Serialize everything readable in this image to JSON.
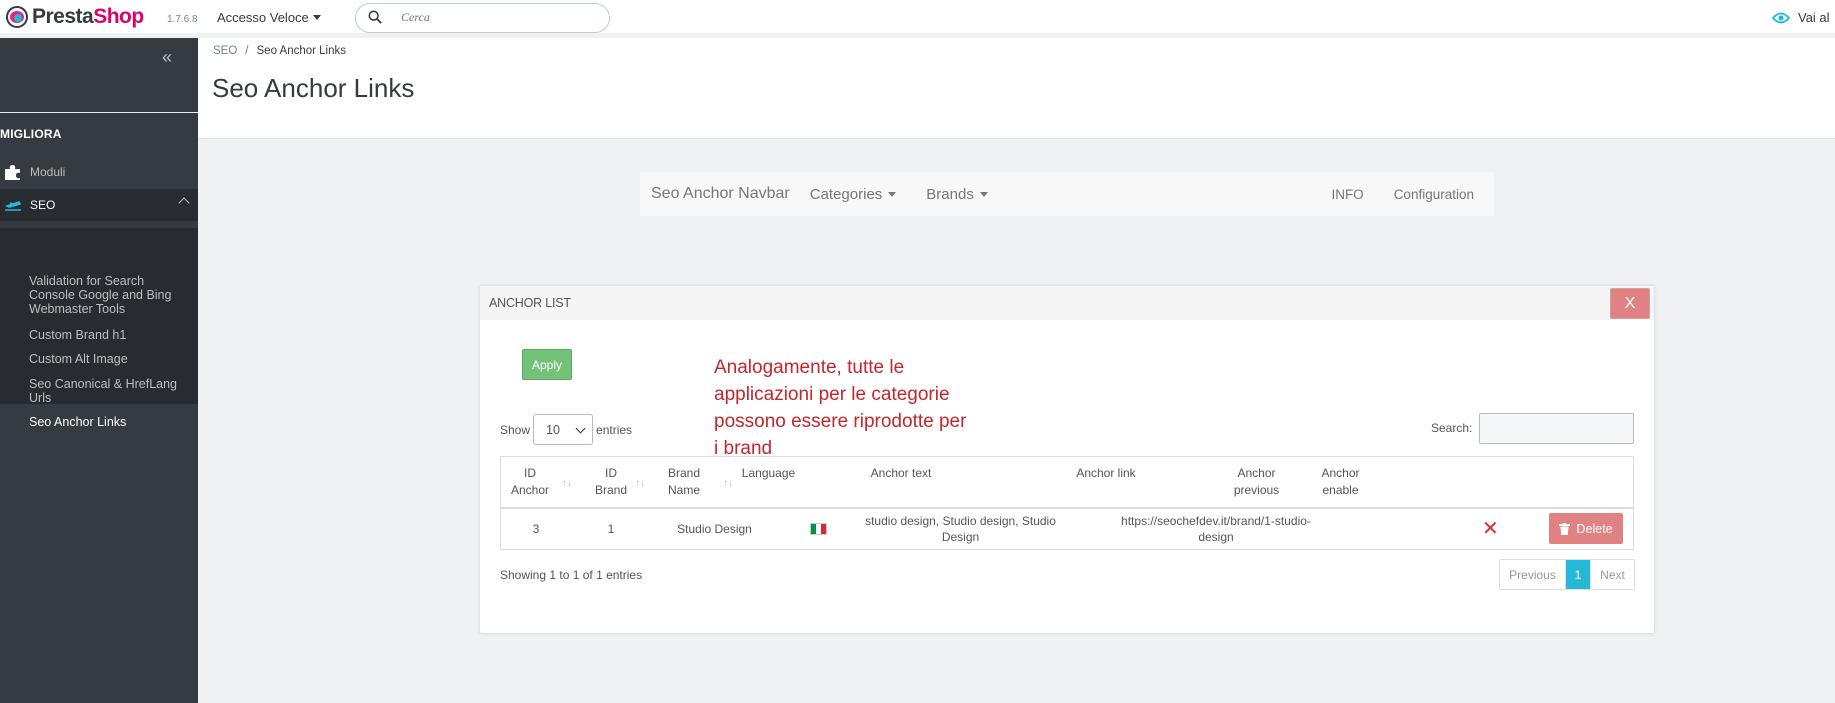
{
  "header": {
    "logo_text_1": "Presta",
    "logo_text_2": "Shop",
    "version": "1.7.6.8",
    "quick_access": "Accesso Veloce",
    "search_placeholder": "Cerca",
    "view_shop": "Vai al"
  },
  "sidebar": {
    "section": "MIGLIORA",
    "items": [
      {
        "label": "Moduli",
        "icon": "puzzle-icon"
      },
      {
        "label": "SEO",
        "icon": "plane-icon"
      }
    ],
    "sub_items": [
      "Validation for Search Console Google and Bing Webmaster Tools",
      "Custom Brand h1",
      "Custom Alt Image",
      "Seo Canonical & HrefLang Urls",
      "Seo Anchor Links"
    ]
  },
  "breadcrumb": {
    "parent": "SEO",
    "current": "Seo Anchor Links"
  },
  "page_title": "Seo Anchor Links",
  "module_nav": {
    "brand": "Seo Anchor Navbar",
    "categories": "Categories",
    "brands": "Brands",
    "info": "INFO",
    "configuration": "Configuration"
  },
  "panel": {
    "title": "ANCHOR LIST",
    "close": "X",
    "apply": "Apply",
    "annotation": "Analogamente, tutte le applicazioni per le categorie possono essere riprodotte per i brand",
    "show_label": "Show",
    "show_value": "10",
    "entries_label": "entries",
    "search_label": "Search:",
    "columns": [
      "ID Anchor",
      "ID Brand",
      "Brand Name",
      "Language",
      "Anchor text",
      "Anchor link",
      "Anchor previous",
      "Anchor enable"
    ],
    "rows": [
      {
        "id_anchor": "3",
        "id_brand": "1",
        "brand_name": "Studio Design",
        "language_flag": "italy-flag",
        "anchor_text": "studio design, Studio design, Studio Design",
        "anchor_link": "https://seochefdev.it/brand/1-studio-design",
        "anchor_previous": "",
        "anchor_enable": "disabled",
        "delete_label": "Delete"
      }
    ],
    "info": "Showing 1 to 1 of 1 entries",
    "pager": {
      "previous": "Previous",
      "page": "1",
      "next": "Next"
    }
  },
  "colors": {
    "accent": "#25b9d7",
    "brand_pink": "#df0067",
    "sidebar": "#363a41",
    "danger": "#e08283",
    "success": "#72c279",
    "annotation": "#c1272d"
  }
}
